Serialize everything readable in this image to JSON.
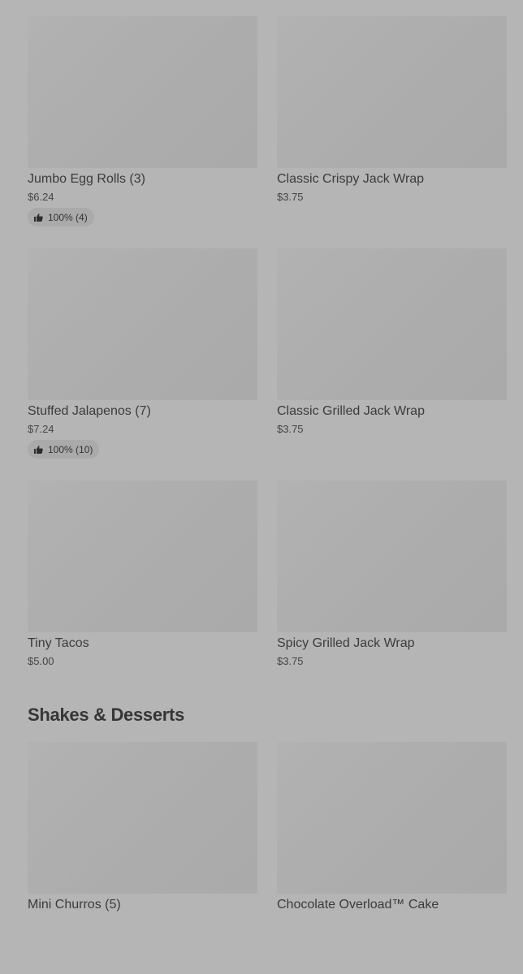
{
  "items": [
    {
      "name": "Jumbo Egg Rolls (3)",
      "price": "$6.24",
      "rating": "100% (4)"
    },
    {
      "name": "Classic Crispy Jack Wrap",
      "price": "$3.75"
    },
    {
      "name": "Stuffed Jalapenos (7)",
      "price": "$7.24",
      "rating": "100% (10)"
    },
    {
      "name": "Classic Grilled Jack Wrap",
      "price": "$3.75"
    },
    {
      "name": "Tiny Tacos",
      "price": "$5.00"
    },
    {
      "name": "Spicy Grilled Jack Wrap",
      "price": "$3.75"
    }
  ],
  "section": {
    "title": "Shakes & Desserts"
  },
  "section_items": [
    {
      "name": "Mini Churros (5)"
    },
    {
      "name": "Chocolate Overload™ Cake"
    }
  ]
}
